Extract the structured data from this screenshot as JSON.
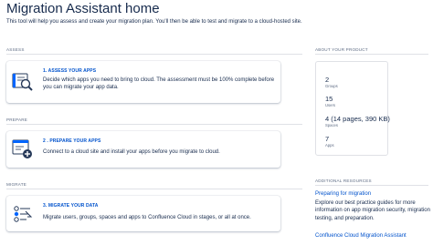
{
  "header": {
    "title": "Migration Assistant home",
    "intro": "This tool will help you assess and create your migration plan. You'll then be able to test and migrate to a cloud-hosted site."
  },
  "sections": {
    "assess": {
      "label": "ASSESS",
      "card_title": "1. ASSESS YOUR APPS",
      "card_desc": "Decide which apps you need to bring to cloud. The assessment must be 100% complete before you can migrate your app data.",
      "icon": "assess-magnifier-icon"
    },
    "prepare": {
      "label": "PREPARE",
      "card_title": "2 . PREPARE YOUR APPS",
      "card_desc": "Connect to a cloud site and install your apps before you migrate to cloud.",
      "icon": "prepare-add-icon"
    },
    "migrate": {
      "label": "MIGRATE",
      "card_title": "3. MIGRATE YOUR DATA",
      "card_desc": "Migrate users, groups, spaces and apps to Confluence Cloud in stages, or all at once.",
      "icon": "migrate-checklist-icon"
    }
  },
  "about": {
    "label": "ABOUT YOUR PRODUCT",
    "stats": [
      {
        "value": "2",
        "label": "Groups"
      },
      {
        "value": "15",
        "label": "Users"
      },
      {
        "value": "4 (14 pages, 390 KB)",
        "label": "Spaces"
      },
      {
        "value": "7",
        "label": "Apps"
      }
    ]
  },
  "resources": {
    "label": "ADDITIONAL RESOURCES",
    "link1": "Preparing for migration",
    "text": "Explore our best practice guides for more information on app migration security, migration testing, and preparation.",
    "link2": "Confluence Cloud Migration Assistant"
  },
  "colors": {
    "link": "#0052cc",
    "text": "#172b4d",
    "muted": "#5e6c84",
    "border": "#dfe1e6",
    "icon_dark": "#253858",
    "icon_blue": "#0065ff"
  }
}
